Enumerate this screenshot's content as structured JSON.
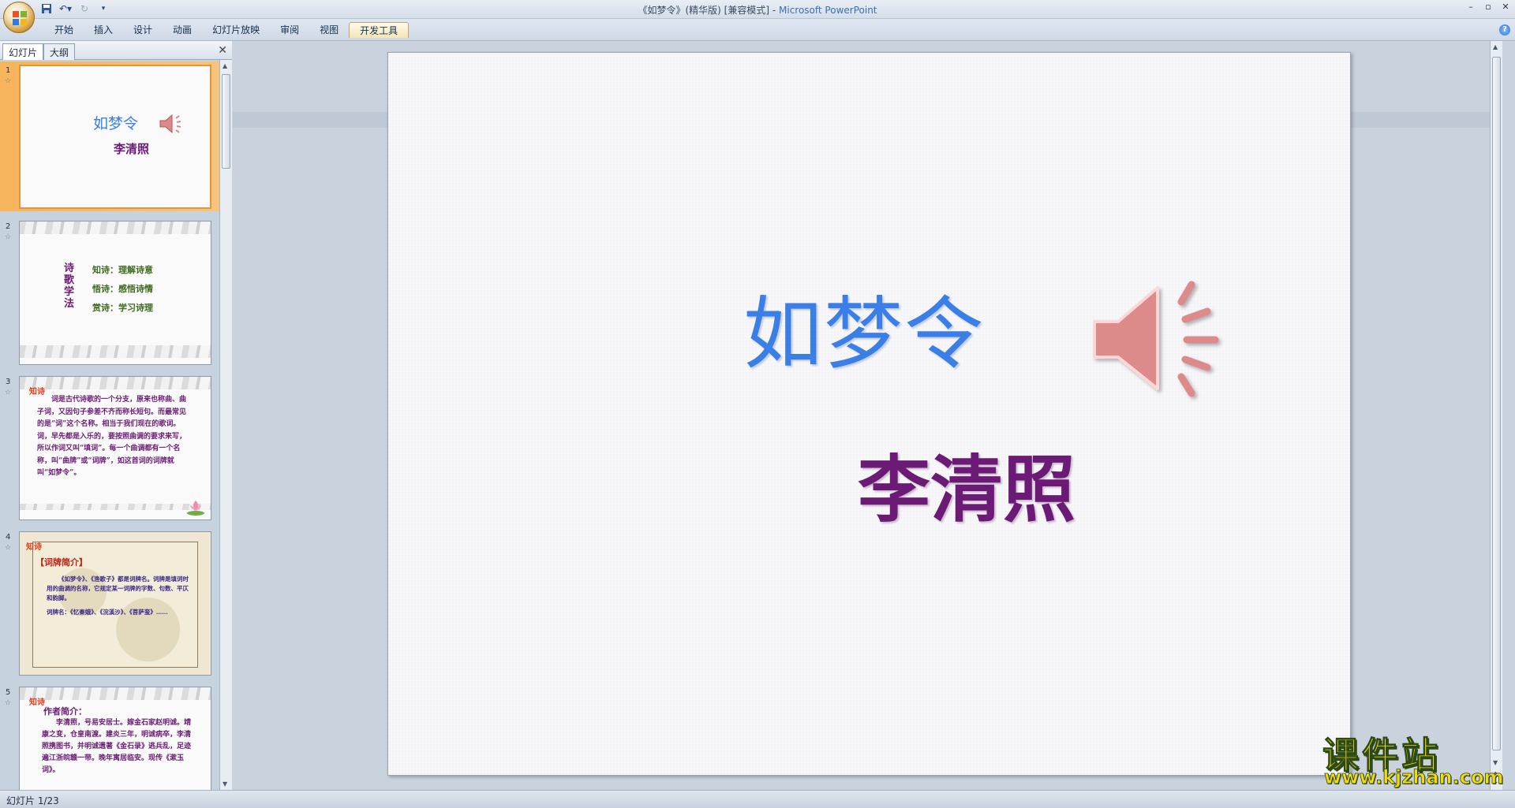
{
  "window": {
    "title": "《如梦令》(精华版) [兼容模式] - ",
    "app_name": "Microsoft PowerPoint",
    "controls": [
      "–",
      "▫",
      "✕"
    ]
  },
  "ribbon": {
    "tabs": [
      {
        "label": "开始"
      },
      {
        "label": "插入"
      },
      {
        "label": "设计"
      },
      {
        "label": "动画"
      },
      {
        "label": "幻灯片放映"
      },
      {
        "label": "审阅"
      },
      {
        "label": "视图"
      },
      {
        "label": "开发工具",
        "active": true
      }
    ],
    "help": "?"
  },
  "pane": {
    "tabs": [
      "幻灯片",
      "大纲"
    ],
    "close": "✕",
    "thumbnails": [
      {
        "num": "1",
        "title": "如梦令",
        "author": "李清照"
      },
      {
        "num": "2",
        "vertical": "诗歌学法",
        "lines": [
          "知诗：理解诗意",
          "悟诗：感悟诗情",
          "赏诗：学习诗理"
        ]
      },
      {
        "num": "3",
        "head": "知诗",
        "body": "词是古代诗歌的一个分支，原来也称曲、曲子词，又因句子参差不齐而称长短句。而最常见的是“词”这个名称。相当于我们现在的歌词。词，早先都是入乐的，要按照曲调的要求来写，所以作词又叫“填词”。每一个曲调都有一个名称，叫“曲牌”或“词牌”，如这首词的词牌就叫“如梦令”。"
      },
      {
        "num": "4",
        "head": "知诗",
        "sub": "【词牌简介】",
        "body": "《如梦令》、《渔歌子》都是词牌名。词牌是填词时用的曲调的名称，它规定某一词牌的字数、句数、平仄和韵脚。",
        "body2": "词牌名：《忆秦娥》、《浣溪沙》、《菩萨蛮》……"
      },
      {
        "num": "5",
        "head": "知诗",
        "sub": "作者简介：",
        "body": "李清照，号易安居士。嫁金石家赵明诚。靖康之变，仓皇南渡。建炎三年，明诚病卒，李清照携图书，并明诚遗著《金石录》逃兵乱，足迹遍江浙皖赣一带。晚年寓居临安。现传《漱玉词》。"
      }
    ]
  },
  "slide": {
    "title": "如梦令",
    "author": "李清照",
    "colors": {
      "title": "#3a7ee8",
      "author": "#6b1b75"
    },
    "speaker_icon": "speaker-icon"
  },
  "status": {
    "text": "幻灯片 1/23"
  },
  "watermark": {
    "cn": "课件站",
    "url": "www.kjzhan.com"
  }
}
